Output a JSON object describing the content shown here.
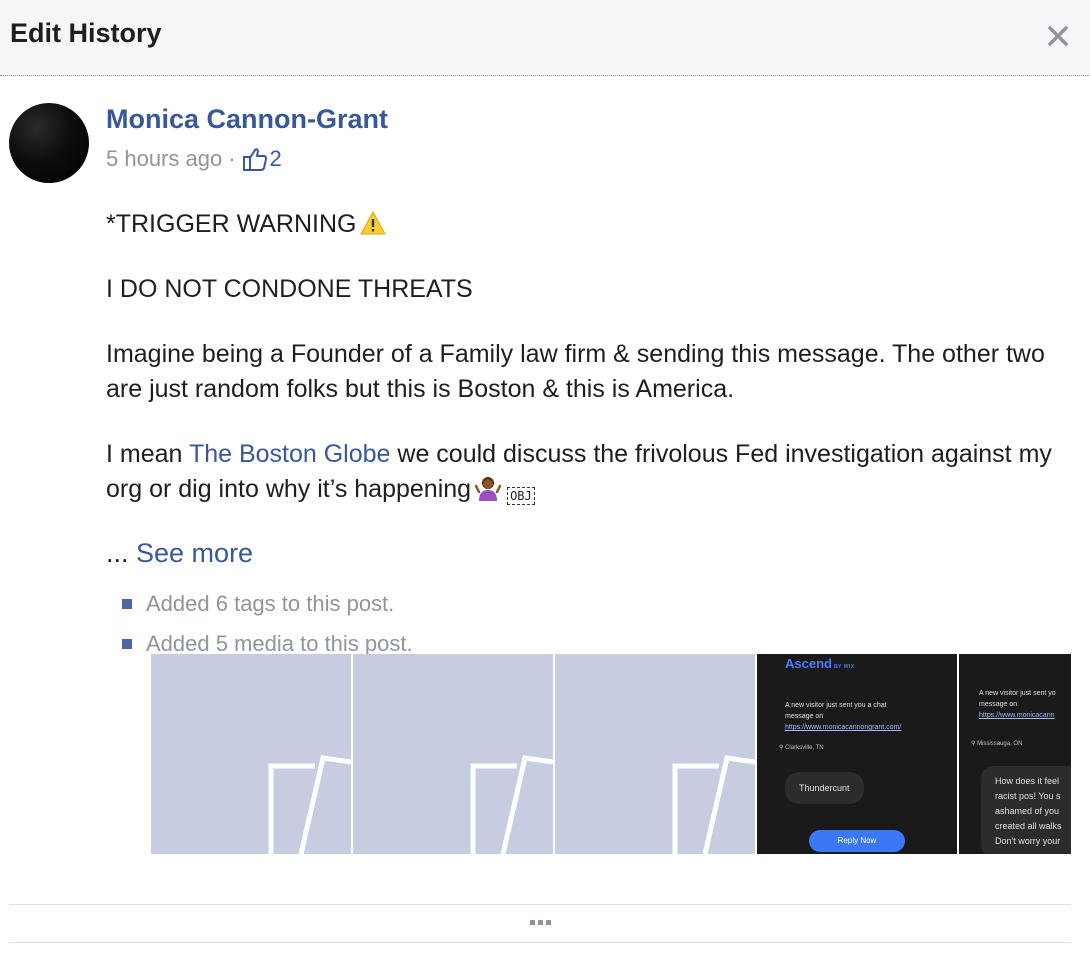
{
  "dialog": {
    "title": "Edit History",
    "close_label": "×"
  },
  "post": {
    "author": "Monica Cannon-Grant",
    "timestamp": "5 hours ago",
    "separator": "·",
    "like_count": "2",
    "paragraphs": {
      "p1": "*TRIGGER WARNING",
      "p2": "I DO NOT CONDONE THREATS",
      "p3": "Imagine being a Founder of a Family law firm & sending this message. The other two are just random folks but this is Boston & this is America.",
      "p4_before": "I mean ",
      "p4_link": "The Boston Globe",
      "p4_after": " we could discuss the frivolous Fed investigation against my org or dig into why it’s happening",
      "obj_glyph": "OBJ"
    },
    "see_more_prefix": "... ",
    "see_more_label": "See more"
  },
  "history": {
    "items": [
      "Added 6 tags to this post.",
      "Added 5 media to this post."
    ]
  },
  "media": {
    "count": 5,
    "thumb4": {
      "brand": "Ascend",
      "brand_sub": "BY WIX",
      "message_line1": "A new visitor just sent you a chat",
      "message_line2": "message on",
      "url": "https://www.monicacannongrant.com/",
      "location": "Clarksville, TN",
      "bubble": "Thundercunt",
      "reply": "Reply Now"
    },
    "thumb5": {
      "message_line1": "A new visitor just sent yo",
      "message_line2": "message on",
      "url": "https://www.monicacann",
      "location": "Mississauga, ON",
      "bubble_lines": [
        "How does it feel",
        "racist pos! You s",
        "ashamed of you",
        "created all walks",
        "Don't worry your"
      ]
    }
  },
  "footer": {
    "more_icon": "ellipsis-icon"
  },
  "colors": {
    "link": "#385898",
    "muted": "#90949c",
    "header_bg": "#f5f6f7",
    "placeholder_bg": "#c6cde0"
  }
}
